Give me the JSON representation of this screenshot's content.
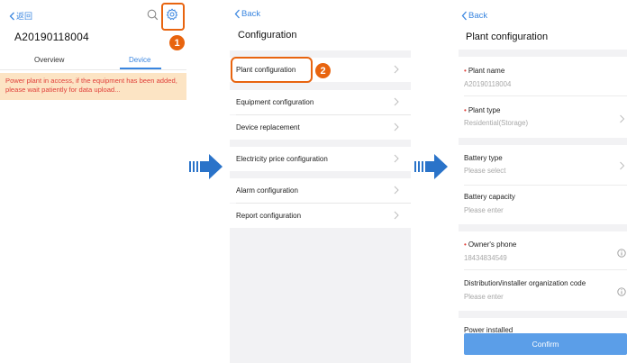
{
  "screen1": {
    "back_label": "返回",
    "plant_id": "A20190118004",
    "tabs": [
      {
        "label": "Overview",
        "active": false
      },
      {
        "label": "Device",
        "active": true
      }
    ],
    "banner": "Power plant in access, if the equipment has been added, please wait patiently for data upload...",
    "step_badge": "1",
    "icons": [
      "search-icon",
      "gear-icon"
    ]
  },
  "screen2": {
    "back_label": "Back",
    "title": "Configuration",
    "step_badge": "2",
    "items": [
      {
        "label": "Plant configuration",
        "highlighted": true
      },
      {
        "label": "Equipment configuration"
      },
      {
        "label": "Device replacement"
      },
      {
        "label": "Electricity price configuration"
      },
      {
        "label": "Alarm configuration"
      },
      {
        "label": "Report configuration"
      }
    ]
  },
  "screen3": {
    "back_label": "Back",
    "title": "Plant configuration",
    "fields": [
      {
        "label": "Plant name",
        "required": true,
        "value": "A20190118004"
      },
      {
        "label": "Plant type",
        "required": true,
        "value": "Residential(Storage)"
      },
      {
        "label": "Battery type",
        "required": false,
        "value": "Please select"
      },
      {
        "label": "Battery capacity",
        "required": false,
        "value": "Please enter"
      },
      {
        "label": "Owner's phone",
        "required": true,
        "value": "18434834549"
      },
      {
        "label": "Distribution/installer organization code",
        "required": false,
        "value": "Please enter"
      }
    ],
    "cut_off_label": "Power installed",
    "confirm_label": "Confirm"
  },
  "colors": {
    "accent": "#3a86e0",
    "callout": "#e8640f",
    "warning_bg": "#fce4c4",
    "warning_text": "#e0403a",
    "arrow": "#2a73c9",
    "button": "#5b9ee8"
  }
}
